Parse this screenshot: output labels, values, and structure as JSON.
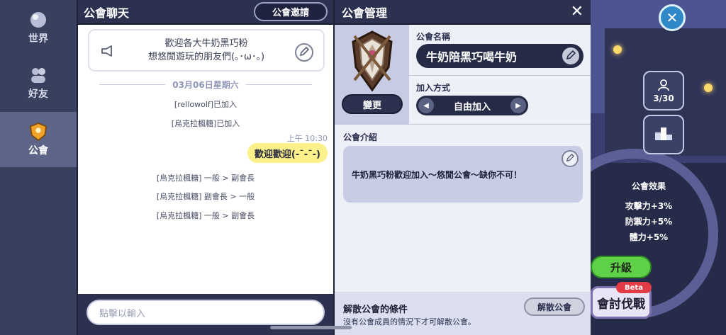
{
  "rail": {
    "items": [
      {
        "label": "世界",
        "icon": "globe-icon"
      },
      {
        "label": "好友",
        "icon": "friends-icon"
      },
      {
        "label": "公會",
        "icon": "guild-shield-icon",
        "active": true
      }
    ]
  },
  "chat": {
    "title": "公會聊天",
    "invite_label": "公會邀請",
    "notice_line1": "歡迎各大牛奶黑巧粉",
    "notice_line2": "想悠閒遊玩的朋友們(｡･ω･｡)",
    "date": "03月06日星期六",
    "messages": [
      "[rellowolf]已加入",
      "[烏克拉楓糖]已加入"
    ],
    "bubble_time": "上午 10:30",
    "bubble_text": "歡迎歡迎(-ˉ-ˉ-)",
    "role_changes": [
      "[烏克拉楓糖] 一般 > 副會長",
      "[烏克拉楓糖] 副會長 > 一般",
      "[烏克拉楓糖] 一般 > 副會長"
    ],
    "input_placeholder": "點擊以輸入"
  },
  "mgmt": {
    "title": "公會管理",
    "change_label": "變更",
    "name_label": "公會名稱",
    "name_value": "牛奶陪黑巧喝牛奶",
    "join_label": "加入方式",
    "join_value": "自由加入",
    "intro_label": "公會介紹",
    "intro_text": "牛奶黑巧粉歡迎加入～悠閒公會～缺你不可！",
    "disband_title": "解散公會的條件",
    "disband_desc": "沒有公會成員的情況下才可解散公會。",
    "disband_label": "解散公會"
  },
  "game": {
    "members": "3/30",
    "effects_title": "公會效果",
    "effects": [
      "攻擊力+3%",
      "防禦力+5%",
      "體力+5%"
    ],
    "upgrade_label": "升級",
    "battle_label": "會討伐戰",
    "beta_label": "Beta"
  }
}
